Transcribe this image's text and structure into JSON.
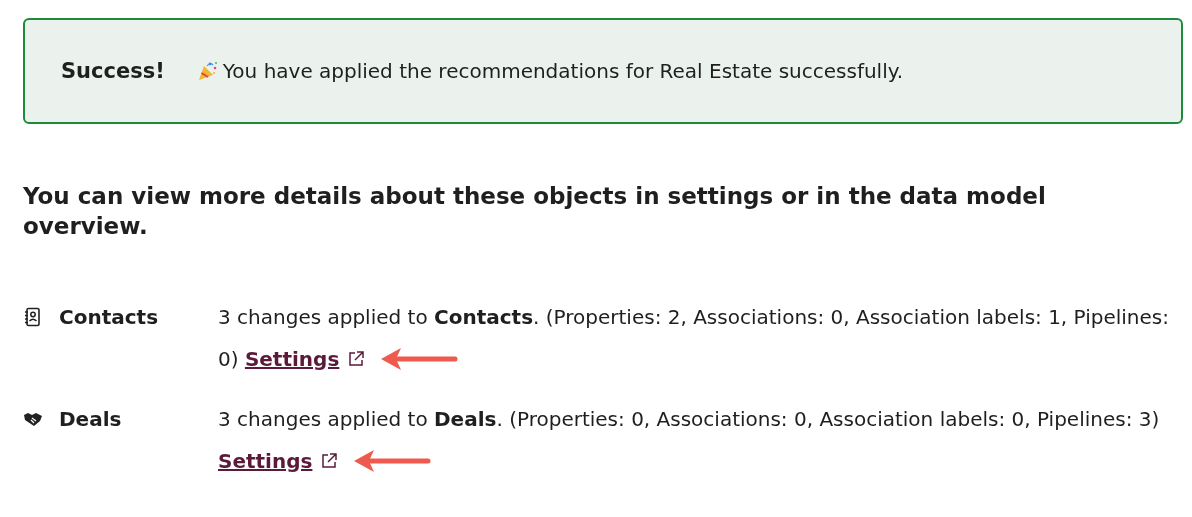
{
  "alert": {
    "title": "Success!",
    "message": "You have applied the recommendations for Real Estate successfully."
  },
  "heading": "You can view more details about these objects in settings or in the data model overview.",
  "objects": [
    {
      "kind": "contacts",
      "name": "Contacts",
      "summary": "3 changes applied to **Contacts**. (Properties: 2, Associations: 0, Association labels: 1, Pipelines: 0)",
      "link": "Settings",
      "annotated": true
    },
    {
      "kind": "deals",
      "name": "Deals",
      "summary": "3 changes applied to **Deals**. (Properties: 0, Associations: 0, Association labels: 0, Pipelines: 3)",
      "link": "Settings",
      "annotated": true
    }
  ]
}
